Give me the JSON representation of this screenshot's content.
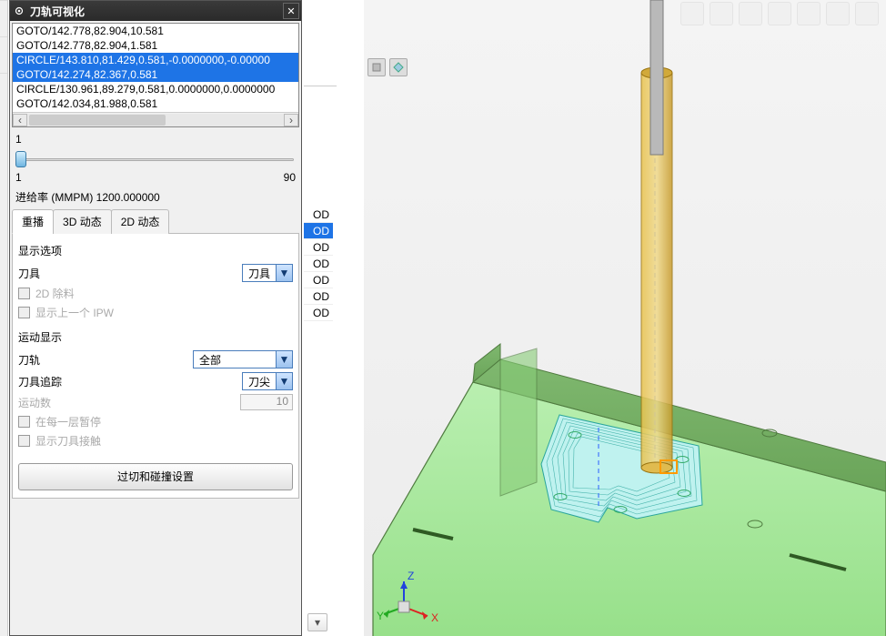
{
  "dialog": {
    "title": "刀轨可视化",
    "nc_lines": [
      {
        "text": "GOTO/142.778,82.904,10.581",
        "selected": false
      },
      {
        "text": "GOTO/142.778,82.904,1.581",
        "selected": false
      },
      {
        "text": "CIRCLE/143.810,81.429,0.581,-0.0000000,-0.00000",
        "selected": true
      },
      {
        "text": "GOTO/142.274,82.367,0.581",
        "selected": true
      },
      {
        "text": "CIRCLE/130.961,89.279,0.581,0.0000000,0.0000000",
        "selected": false
      },
      {
        "text": "GOTO/142.034,81.988,0.581",
        "selected": false
      }
    ],
    "scroll_left_glyph": "‹",
    "scroll_right_glyph": "›",
    "slider": {
      "top": "1",
      "min": "1",
      "max": "90"
    },
    "feedrate_label": "进给率 (MMPM) 1200.000000",
    "tabs": [
      "重播",
      "3D 动态",
      "2D 动态"
    ],
    "active_tab": 0,
    "display": {
      "section": "显示选项",
      "tool_label": "刀具",
      "tool_value": "刀具",
      "cb_2d_stock": "2D 除料",
      "cb_show_prev_ipw": "显示上一个 IPW"
    },
    "motion": {
      "section": "运动显示",
      "path_label": "刀轨",
      "path_value": "全部",
      "track_label": "刀具追踪",
      "track_value": "刀尖",
      "num_label": "运动数",
      "num_value": "10",
      "cb_pause_layer": "在每一层暂停",
      "cb_show_contact": "显示刀具接触"
    },
    "big_button": "过切和碰撞设置"
  },
  "od_list": [
    "OD",
    "OD",
    "OD",
    "OD",
    "OD",
    "OD",
    "OD"
  ],
  "od_selected_index": 1,
  "viewport": {
    "axes": {
      "x": "X",
      "y": "Y",
      "z": "Z"
    }
  },
  "dropdown_glyph": "▼",
  "close_glyph": "✕",
  "collapse_glyph": "▾"
}
